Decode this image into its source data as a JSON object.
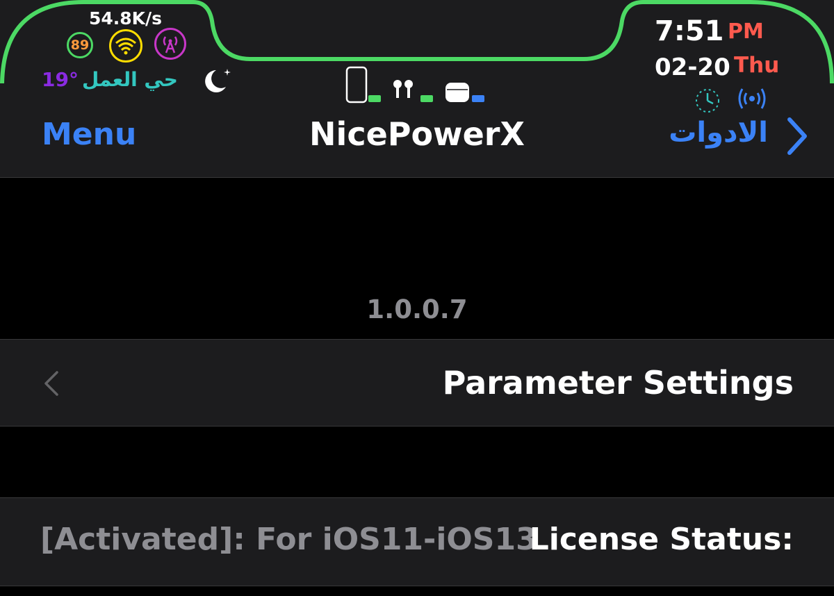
{
  "status_bar": {
    "net_speed": "54.8K/s",
    "battery_level": "89",
    "temperature": "19°",
    "location": "حي العمل",
    "time": "7:51",
    "ampm": "PM",
    "date": "02-20",
    "weekday": "Thu",
    "outline_color": "#4cd964",
    "icons": [
      "wifi-icon",
      "cell-tower-icon",
      "moon-icon",
      "phone-icon",
      "airpods-icon",
      "airpods-case-icon",
      "clock-icon",
      "broadcast-icon"
    ]
  },
  "navbar": {
    "left_label": "Menu",
    "title": "NicePowerX",
    "right_label": "الادوات",
    "accent_color": "#3b82f6"
  },
  "header": {
    "version": "1.0.0.7"
  },
  "rows": {
    "parameter_settings": "Parameter Settings",
    "license_value": "[Activated]:  For iOS11-iOS13",
    "license_label": "License Status:"
  }
}
